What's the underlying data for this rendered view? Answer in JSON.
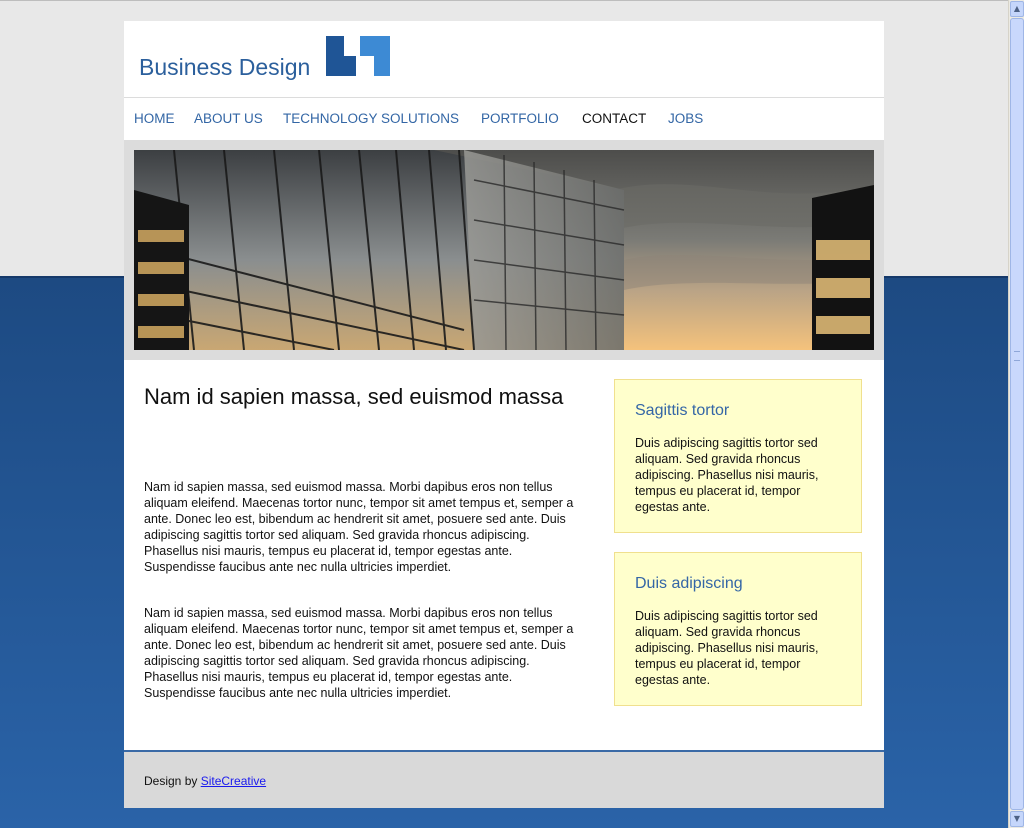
{
  "colors": {
    "brand": "#2b5f9c",
    "nav": "#3366a5",
    "box_bg": "#ffffcc",
    "bg_blue": "#2a63a8"
  },
  "header": {
    "logo_text": "Business Design",
    "logo_icon": "business-logo-mark"
  },
  "nav": {
    "items": [
      {
        "label": "HOME"
      },
      {
        "label": "ABOUT US"
      },
      {
        "label": "TECHNOLOGY SOLUTIONS"
      },
      {
        "label": "PORTFOLIO"
      },
      {
        "label": "CONTACT",
        "active": true
      },
      {
        "label": "JOBS"
      }
    ]
  },
  "banner": {
    "image": "building-reflection-sunset"
  },
  "main": {
    "title": "Nam id sapien massa, sed euismod massa",
    "paragraphs": [
      "Nam id sapien massa, sed euismod massa. Morbi dapibus eros non tellus aliquam eleifend. Maecenas tortor nunc, tempor sit amet tempus et, semper a ante. Donec leo est, bibendum ac hendrerit sit amet, posuere sed ante. Duis adipiscing sagittis tortor sed aliquam. Sed gravida rhoncus adipiscing. Phasellus nisi mauris, tempus eu placerat id, tempor egestas ante. Suspendisse faucibus ante nec nulla ultricies imperdiet.",
      "Nam id sapien massa, sed euismod massa. Morbi dapibus eros non tellus aliquam eleifend. Maecenas tortor nunc, tempor sit amet tempus et, semper a ante. Donec leo est, bibendum ac hendrerit sit amet, posuere sed ante. Duis adipiscing sagittis tortor sed aliquam. Sed gravida rhoncus adipiscing. Phasellus nisi mauris, tempus eu placerat id, tempor egestas ante. Suspendisse faucibus ante nec nulla ultricies imperdiet."
    ]
  },
  "sidebar": {
    "boxes": [
      {
        "title": "Sagittis tortor",
        "text": "Duis adipiscing sagittis tortor sed aliquam. Sed gravida rhoncus adipiscing. Phasellus nisi mauris, tempus eu placerat id, tempor egestas ante."
      },
      {
        "title": "Duis adipiscing",
        "text": "Duis adipiscing sagittis tortor sed aliquam. Sed gravida rhoncus adipiscing. Phasellus nisi mauris, tempus eu placerat id, tempor egestas ante."
      }
    ]
  },
  "footer": {
    "prefix": "Design by ",
    "link_text": "SiteCreative"
  }
}
